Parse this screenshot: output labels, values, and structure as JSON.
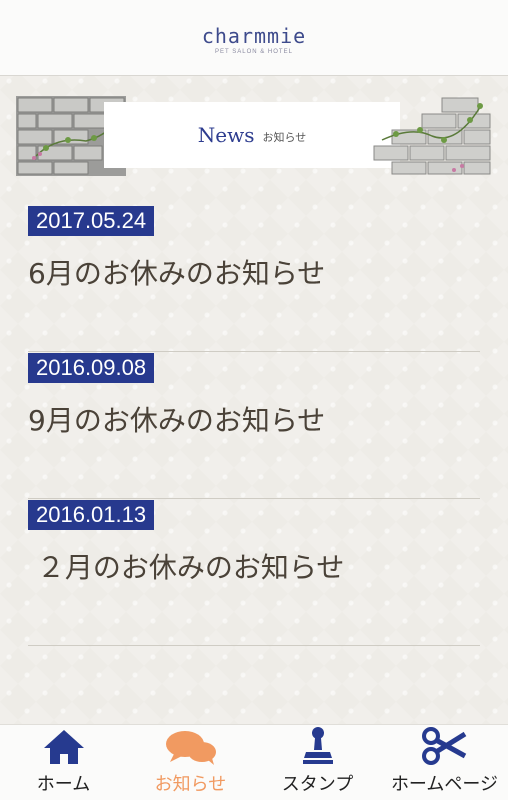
{
  "header": {
    "logo_text": "charmmie",
    "logo_sub": "PET SALON & HOTEL"
  },
  "banner": {
    "title": "News",
    "subtitle": "お知らせ"
  },
  "news": [
    {
      "date": "2017.05.24",
      "title": "6月のお休みのお知らせ"
    },
    {
      "date": "2016.09.08",
      "title": "9月のお休みのお知らせ"
    },
    {
      "date": "2016.01.13",
      "title": " ２月のお休みのお知らせ"
    }
  ],
  "tabs": [
    {
      "label": "ホーム",
      "icon": "home-icon",
      "active": false
    },
    {
      "label": "お知らせ",
      "icon": "chat-bubbles-icon",
      "active": true
    },
    {
      "label": "スタンプ",
      "icon": "stamp-icon",
      "active": false
    },
    {
      "label": "ホームページ",
      "icon": "scissors-icon",
      "active": false
    }
  ],
  "colors": {
    "accent": "#27398e",
    "active_tab": "#f19a61",
    "icon": "#263a8f"
  }
}
